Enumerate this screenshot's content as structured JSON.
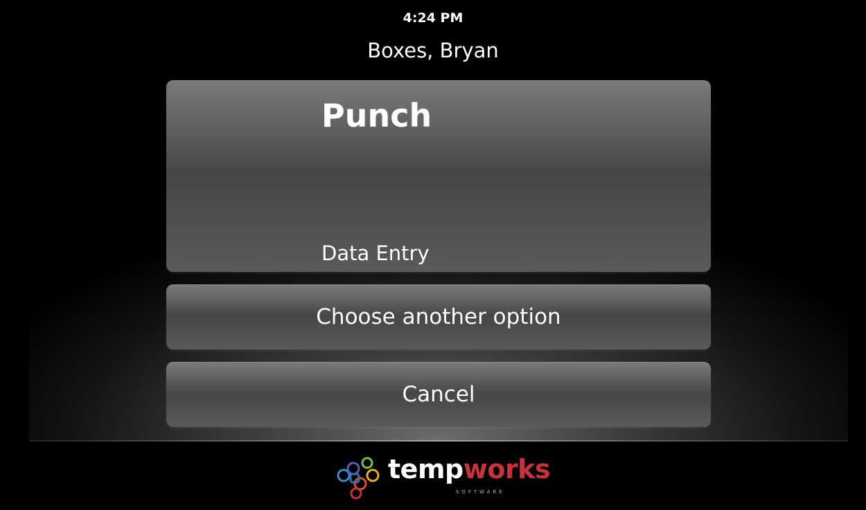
{
  "header": {
    "time": "4:24 PM",
    "user_name": "Boxes, Bryan"
  },
  "punch_tile": {
    "title": "Punch",
    "subtitle": "Data Entry"
  },
  "buttons": {
    "choose_another": "Choose another option",
    "cancel": "Cancel"
  },
  "brand": {
    "name_part1": "temp",
    "name_part2": "works",
    "tagline": "SOFTWARE",
    "accent_color": "#c8323a"
  }
}
